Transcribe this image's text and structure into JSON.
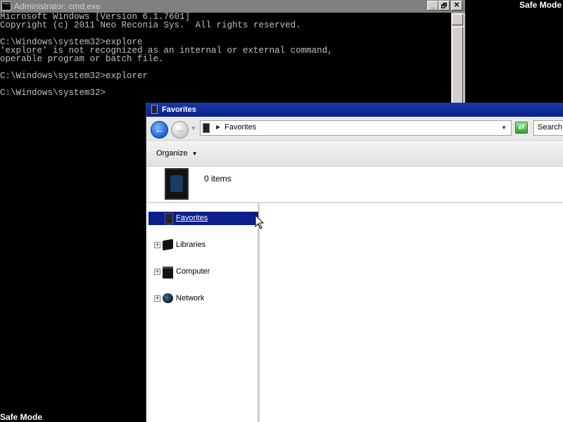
{
  "desktop": {
    "safe_mode_label": "Safe Mode"
  },
  "cmd": {
    "title": "Administrator: cmd.exe",
    "controls": {
      "minimize": "_",
      "restore": "🗗",
      "close": "✕"
    },
    "lines": [
      "Microsoft Windows [Version 6.1.7601]",
      "Copyright (c) 2011 Neo Reconia Sys.  All rights reserved.",
      "",
      "C:\\Windows\\system32>explore",
      "'explore' is not recognized as an internal or external command,",
      "operable program or batch file.",
      "",
      "C:\\Windows\\system32>explorer",
      "",
      "C:\\Windows\\system32>"
    ]
  },
  "explorer": {
    "title": "Favorites",
    "address": "Favorites",
    "search_placeholder": "Search",
    "organize_label": "Organize",
    "item_count": "0 items",
    "nav_items": [
      {
        "label": "Favorites",
        "icon": "favorites-icon",
        "selected": true,
        "expandable": false
      },
      {
        "label": "Libraries",
        "icon": "libraries-icon",
        "selected": false,
        "expandable": true
      },
      {
        "label": "Computer",
        "icon": "computer-icon",
        "selected": false,
        "expandable": true
      },
      {
        "label": "Network",
        "icon": "network-icon",
        "selected": false,
        "expandable": true
      }
    ],
    "colors": {
      "title_bar": "#0a1f8a",
      "selection": "#0a1f8a"
    }
  }
}
